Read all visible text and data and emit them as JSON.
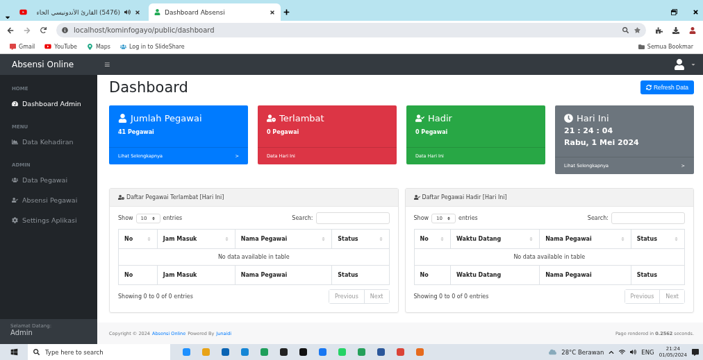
{
  "browser": {
    "tabs": [
      {
        "title": "(5476) القارئ الأندونيسي الحاء",
        "selected": false,
        "audio": true
      },
      {
        "title": "Dashboard Absensi",
        "selected": true
      }
    ],
    "address": "localhost/kominfogayo/public/dashboard",
    "bookmarks": [
      "Gmail",
      "YouTube",
      "Maps",
      "Log in to SlideShare"
    ],
    "bookmark_folder": "Semua Bookmar"
  },
  "app": {
    "brand": "Absensi Online",
    "menu_glyph": "≡"
  },
  "sidebar": {
    "sections": [
      {
        "heading": "HOME",
        "items": [
          {
            "label": "Dashboard Admin",
            "selected": true,
            "kind": "gauge"
          }
        ]
      },
      {
        "heading": "MENU",
        "items": [
          {
            "label": "Data Kehadiran",
            "selected": false,
            "kind": "chart"
          }
        ]
      },
      {
        "heading": "ADMIN",
        "items": [
          {
            "label": "Data Pegawai",
            "selected": false,
            "kind": "users"
          },
          {
            "label": "Absensi Pegawai",
            "selected": false,
            "kind": "usercheck"
          },
          {
            "label": "Settings Aplikasi",
            "selected": false,
            "kind": "gear"
          }
        ]
      }
    ],
    "greeting": "Selamat Datang:",
    "user": "Admin"
  },
  "page": {
    "title": "Dashboard",
    "refresh_button": "Refresh Data"
  },
  "cards": [
    {
      "kind": "user",
      "color": "#007bff",
      "title": "Jumlah Pegawai",
      "lines": [
        "41 Pegawai"
      ],
      "footer": "Lihat Selengkapnya",
      "arrow": ">"
    },
    {
      "kind": "userclock",
      "color": "#dc3545",
      "title": "Terlambat",
      "lines": [
        "0 Pegawai"
      ],
      "footer": "Data Hari Ini"
    },
    {
      "kind": "usercheck",
      "color": "#28a745",
      "title": "Hadir",
      "lines": [
        "0 Pegawai"
      ],
      "footer": "Data Hari Ini"
    },
    {
      "kind": "clock",
      "color": "#6c757d",
      "title": "Hari Ini",
      "lines": [
        "21 : 24 : 04",
        "Rabu, 1 Mei 2024"
      ],
      "footer": "Lihat Selengkapnya",
      "arrow": ">"
    }
  ],
  "panels": [
    {
      "kind": "userclock",
      "title": "Daftar Pegawai Terlambat [Hari Ini]",
      "show": "Show",
      "length": "10",
      "entries": "entries",
      "search": "Search:",
      "columns": [
        "No",
        "Jam Masuk",
        "Nama Pegawai",
        "Status"
      ],
      "empty": "No data available in table",
      "footer_columns": [
        "No",
        "Jam Masuk",
        "Nama Pegawai",
        "Status"
      ],
      "info": "Showing 0 to 0 of 0 entries",
      "pager": [
        "Previous",
        "Next"
      ]
    },
    {
      "kind": "usercheck",
      "title": "Daftar Pegawai Hadir [Hari Ini]",
      "show": "Show",
      "length": "10",
      "entries": "entries",
      "search": "Search:",
      "columns": [
        "No",
        "Waktu Datang",
        "Nama Pegawai",
        "Status"
      ],
      "empty": "No data available in table",
      "footer_columns": [
        "No",
        "Waktu Datang",
        "Nama Pegawai",
        "Status"
      ],
      "info": "Showing 0 to 0 of 0 entries",
      "pager": [
        "Previous",
        "Next"
      ]
    }
  ],
  "footer": {
    "copyright": "Copyright © 2024",
    "brand_link": "Absensi Online",
    "powered": "Powered By",
    "author_link": "Junaidi",
    "render": "Page rendered in **0.2562** seconds."
  },
  "taskbar": {
    "search_placeholder": "Type here to search",
    "weather": "28°C Berawan",
    "language": "ENG",
    "time": "21:24",
    "date": "01/05/2024"
  }
}
